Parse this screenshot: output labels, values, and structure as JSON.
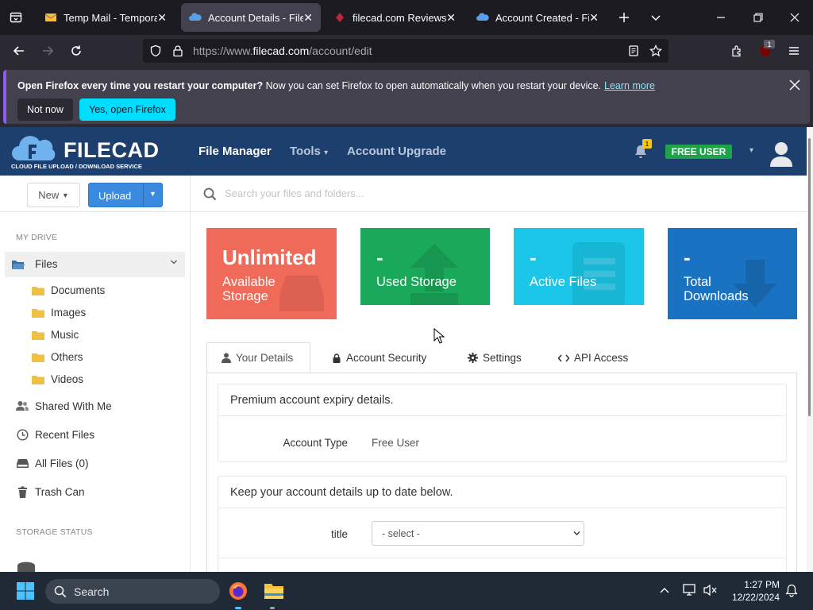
{
  "browser": {
    "tabs": [
      {
        "label": "Temp Mail - Temporary Email",
        "icon": "temp-mail-favicon",
        "active": false
      },
      {
        "label": "Account Details - Filecad",
        "icon": "filecad-favicon",
        "active": true
      },
      {
        "label": "filecad.com Reviews | check",
        "icon": "scam-detector-favicon",
        "active": false
      },
      {
        "label": "Account Created - Filecad",
        "icon": "filecad-favicon",
        "active": false
      }
    ],
    "url": {
      "prefix": "https://www.",
      "domain": "filecad.com",
      "path": "/account/edit"
    },
    "extension_badge": "1"
  },
  "notification": {
    "bold_text": "Open Firefox every time you restart your computer?",
    "text": " Now you can set Firefox to open automatically when you restart your device.",
    "link": "Learn more",
    "not_now": "Not now",
    "yes": "Yes, open Firefox"
  },
  "site": {
    "logo_text": "FILECAD",
    "logo_sub": "CLOUD FILE UPLOAD / DOWNLOAD SERVICE",
    "nav": {
      "file_manager": "File Manager",
      "tools": "Tools",
      "account_upgrade": "Account Upgrade"
    },
    "notification_count": "1",
    "user_badge": "FREE USER",
    "colors": {
      "header": "#1c3f6e",
      "accent_blue": "#3a8be0",
      "free_user_green": "#1fa34a"
    }
  },
  "sidebar": {
    "new_label": "New",
    "upload_label": "Upload",
    "my_drive_title": "MY DRIVE",
    "files_label": "Files",
    "folders": [
      "Documents",
      "Images",
      "Music",
      "Others",
      "Videos"
    ],
    "links": [
      {
        "label": "Shared With Me",
        "icon": "users-icon"
      },
      {
        "label": "Recent Files",
        "icon": "clock-icon"
      },
      {
        "label": "All Files (0)",
        "icon": "hdd-icon"
      },
      {
        "label": "Trash Can",
        "icon": "trash-icon"
      }
    ],
    "storage_title": "STORAGE STATUS"
  },
  "search": {
    "placeholder": "Search your files and folders..."
  },
  "stats": [
    {
      "big": "Unlimited",
      "label": "Available Storage",
      "color": "#f06a5a"
    },
    {
      "big": "-",
      "label": "Used Storage",
      "color": "#1aa85a"
    },
    {
      "big": "-",
      "label": "Active Files",
      "color": "#1bc6e8"
    },
    {
      "big": "-",
      "label": "Total Downloads",
      "color": "#1a73c2"
    }
  ],
  "account_tabs": [
    {
      "label": "Your Details",
      "icon": "user-icon",
      "active": true
    },
    {
      "label": "Account Security",
      "icon": "lock-icon",
      "active": false
    },
    {
      "label": "Settings",
      "icon": "gear-icon",
      "active": false
    },
    {
      "label": "API Access",
      "icon": "code-icon",
      "active": false
    }
  ],
  "premium_box": {
    "heading": "Premium account expiry details.",
    "account_type_label": "Account Type",
    "account_type_value": "Free User"
  },
  "details_box": {
    "heading": "Keep your account details up to date below.",
    "title_label": "title",
    "title_select": "- select -"
  },
  "taskbar": {
    "search_label": "Search",
    "time": "1:27 PM",
    "date": "12/22/2024"
  }
}
